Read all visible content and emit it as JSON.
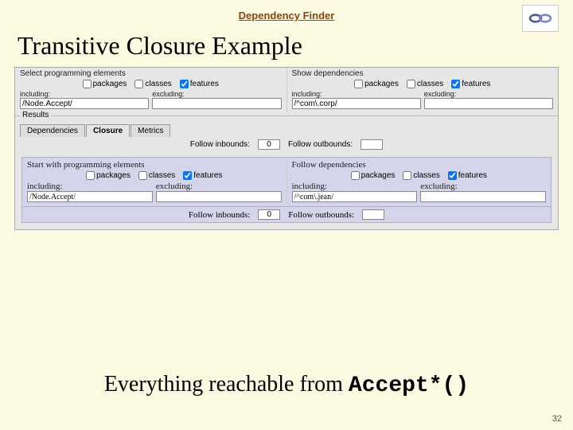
{
  "header": {
    "title": "Dependency Finder"
  },
  "title": "Transitive Closure Example",
  "panel": {
    "left": {
      "label": "Select programming elements",
      "checks": {
        "packages": "packages",
        "classes": "classes",
        "features": "features"
      },
      "including_label": "including:",
      "excluding_label": "excluding:",
      "including_value": "/Node.Accept/"
    },
    "right": {
      "label": "Show dependencies",
      "checks": {
        "packages": "packages",
        "classes": "classes",
        "features": "features"
      },
      "including_label": "including:",
      "excluding_label": "excluding:",
      "including_value": "/^com\\.corp/"
    },
    "results_label": "Results",
    "tabs": {
      "dependencies": "Dependencies",
      "closure": "Closure",
      "metrics": "Metrics"
    },
    "follow": {
      "inbounds_label": "Follow inbounds:",
      "outbounds_label": "Follow outbounds:",
      "inbounds_value": "0",
      "outbounds_value": ""
    }
  },
  "subpanel": {
    "left": {
      "label": "Start with programming elements",
      "checks": {
        "packages": "packages",
        "classes": "classes",
        "features": "features"
      },
      "including_label": "including:",
      "excluding_label": "excluding:",
      "including_value": "/Node.Accept/"
    },
    "right": {
      "label": "Follow dependencies",
      "checks": {
        "packages": "packages",
        "classes": "classes",
        "features": "features"
      },
      "including_label": "including:",
      "excluding_label": "excluding:",
      "including_value": "/^com\\.jean/"
    },
    "follow": {
      "inbounds_label": "Follow inbounds:",
      "outbounds_label": "Follow outbounds:",
      "inbounds_value": "0",
      "outbounds_value": ""
    }
  },
  "bottom": {
    "prefix": "Everything reachable from ",
    "code": "Accept*()"
  },
  "page_number": "32"
}
